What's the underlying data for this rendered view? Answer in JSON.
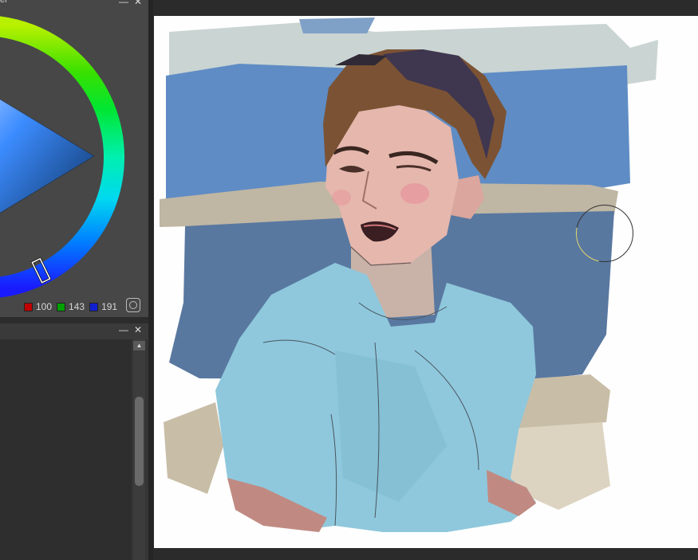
{
  "color_panel": {
    "title": "el",
    "red": "100",
    "green": "143",
    "blue": "191",
    "current_color": "#648fbf"
  },
  "lower_panel": {
    "scroll_up": "▲"
  },
  "window_controls": {
    "minimize": "—",
    "close": "✕"
  },
  "icons": [
    "minimize-icon",
    "close-icon",
    "color-wheel",
    "settings-icon",
    "scroll-up-icon",
    "brush-cursor-icon"
  ]
}
